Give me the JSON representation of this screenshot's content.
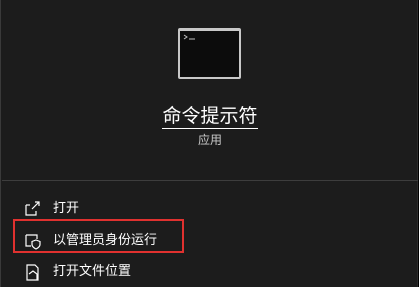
{
  "app": {
    "title": "命令提示符",
    "type_label": "应用",
    "icon": "command-prompt-icon"
  },
  "actions": [
    {
      "label": "打开",
      "icon": "open-icon"
    },
    {
      "label": "以管理员身份运行",
      "icon": "shield-icon"
    },
    {
      "label": "打开文件位置",
      "icon": "folder-icon"
    }
  ],
  "colors": {
    "panel_background": "#1c1c1c",
    "highlight": "#e0312f",
    "text": "#ffffff"
  }
}
